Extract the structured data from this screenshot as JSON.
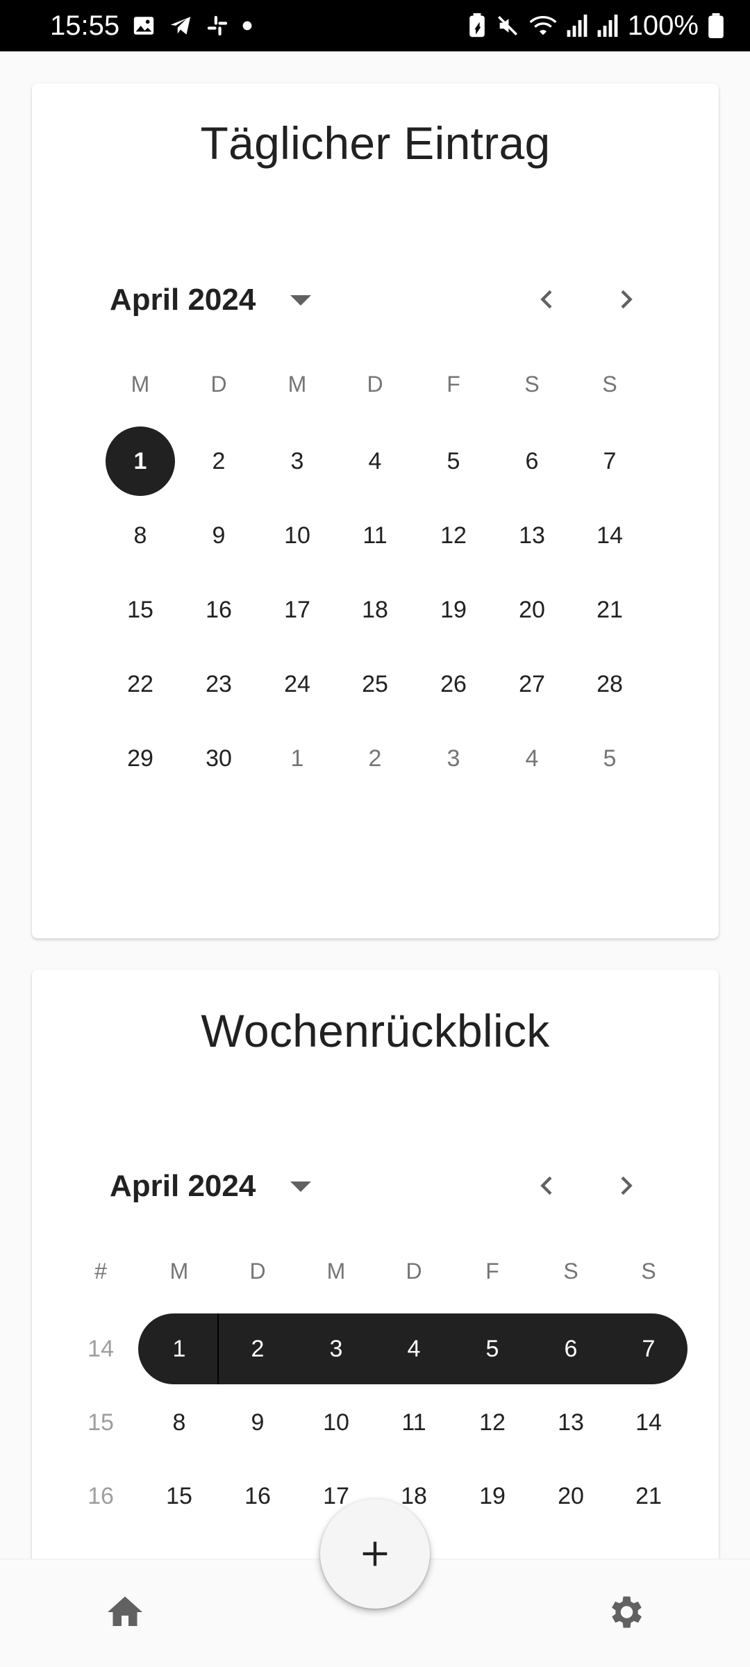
{
  "status_bar": {
    "time": "15:55",
    "battery": "100%",
    "icons_left": [
      "gallery-icon",
      "telegram-icon",
      "slack-icon",
      "dot-icon"
    ],
    "icons_right": [
      "battery-saver-icon",
      "mute-icon",
      "wifi-icon",
      "signal-icon",
      "signal-icon",
      "battery-icon"
    ]
  },
  "daily": {
    "title": "Täglicher Eintrag",
    "month_label": "April 2024",
    "weekdays": [
      "M",
      "D",
      "M",
      "D",
      "F",
      "S",
      "S"
    ],
    "weeks": [
      [
        {
          "d": "1",
          "s": "selected"
        },
        {
          "d": "2"
        },
        {
          "d": "3"
        },
        {
          "d": "4"
        },
        {
          "d": "5"
        },
        {
          "d": "6"
        },
        {
          "d": "7"
        }
      ],
      [
        {
          "d": "8"
        },
        {
          "d": "9"
        },
        {
          "d": "10"
        },
        {
          "d": "11"
        },
        {
          "d": "12"
        },
        {
          "d": "13"
        },
        {
          "d": "14"
        }
      ],
      [
        {
          "d": "15"
        },
        {
          "d": "16"
        },
        {
          "d": "17"
        },
        {
          "d": "18"
        },
        {
          "d": "19"
        },
        {
          "d": "20"
        },
        {
          "d": "21"
        }
      ],
      [
        {
          "d": "22"
        },
        {
          "d": "23"
        },
        {
          "d": "24"
        },
        {
          "d": "25"
        },
        {
          "d": "26"
        },
        {
          "d": "27"
        },
        {
          "d": "28"
        }
      ],
      [
        {
          "d": "29"
        },
        {
          "d": "30"
        },
        {
          "d": "1",
          "s": "muted"
        },
        {
          "d": "2",
          "s": "muted"
        },
        {
          "d": "3",
          "s": "muted"
        },
        {
          "d": "4",
          "s": "muted"
        },
        {
          "d": "5",
          "s": "muted"
        }
      ]
    ]
  },
  "weekly": {
    "title": "Wochenrückblick",
    "month_label": "April 2024",
    "week_col_header": "#",
    "weekdays": [
      "M",
      "D",
      "M",
      "D",
      "F",
      "S",
      "S"
    ],
    "selected_week": "14",
    "weeks": [
      {
        "num": "14",
        "days": [
          "1",
          "2",
          "3",
          "4",
          "5",
          "6",
          "7"
        ]
      },
      {
        "num": "15",
        "days": [
          "8",
          "9",
          "10",
          "11",
          "12",
          "13",
          "14"
        ]
      },
      {
        "num": "16",
        "days": [
          "15",
          "16",
          "17",
          "18",
          "19",
          "20",
          "21"
        ]
      }
    ]
  },
  "bottom_nav": {
    "home_icon": "home-icon",
    "settings_icon": "gear-icon",
    "fab_icon": "plus-icon"
  },
  "colors": {
    "selected": "#212121",
    "muted": "#757575",
    "week_num": "#9e9e9e",
    "background": "#fafafa"
  }
}
